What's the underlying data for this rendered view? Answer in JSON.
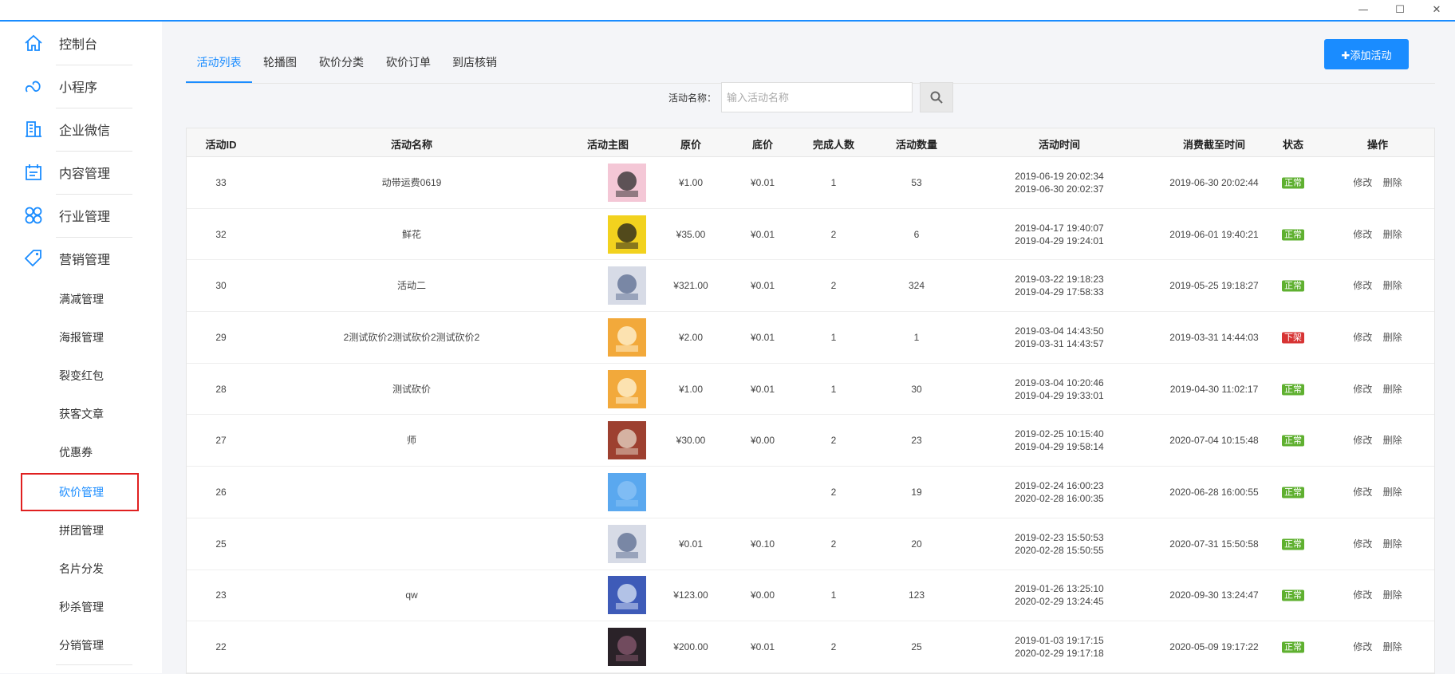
{
  "window": {
    "minimize": "—",
    "maximize": "☐",
    "close": "✕"
  },
  "sidebar": {
    "items": [
      {
        "label": "控制台",
        "icon": "home-icon"
      },
      {
        "label": "小程序",
        "icon": "mini-program-icon"
      },
      {
        "label": "企业微信",
        "icon": "building-icon"
      },
      {
        "label": "内容管理",
        "icon": "calendar-icon"
      },
      {
        "label": "行业管理",
        "icon": "grid-icon"
      },
      {
        "label": "营销管理",
        "icon": "tag-icon"
      }
    ],
    "sub_items": [
      "满减管理",
      "海报管理",
      "裂变红包",
      "获客文章",
      "优惠券",
      "砍价管理",
      "拼团管理",
      "名片分发",
      "秒杀管理",
      "分销管理"
    ],
    "active_sub": "砍价管理"
  },
  "tabs": [
    "活动列表",
    "轮播图",
    "砍价分类",
    "砍价订单",
    "到店核销"
  ],
  "add_button": "✚添加活动",
  "search": {
    "label": "活动名称：",
    "placeholder": "输入活动名称"
  },
  "table": {
    "headers": [
      "活动ID",
      "活动名称",
      "活动主图",
      "原价",
      "底价",
      "完成人数",
      "活动数量",
      "活动时间",
      "消费截至时间",
      "状态",
      "操作"
    ],
    "actions": {
      "edit": "修改",
      "delete": "删除"
    },
    "rows": [
      {
        "id": "33",
        "name": "动带运费0619",
        "price": "¥1.00",
        "floor": "¥0.01",
        "done": "1",
        "qty": "53",
        "start": "2019-06-19 20:02:34",
        "end": "2019-06-30 20:02:37",
        "expire": "2019-06-30 20:02:44",
        "status": "正常"
      },
      {
        "id": "32",
        "name": "鲜花",
        "price": "¥35.00",
        "floor": "¥0.01",
        "done": "2",
        "qty": "6",
        "start": "2019-04-17 19:40:07",
        "end": "2019-04-29 19:24:01",
        "expire": "2019-06-01 19:40:21",
        "status": "正常"
      },
      {
        "id": "30",
        "name": "活动二",
        "price": "¥321.00",
        "floor": "¥0.01",
        "done": "2",
        "qty": "324",
        "start": "2019-03-22 19:18:23",
        "end": "2019-04-29 17:58:33",
        "expire": "2019-05-25 19:18:27",
        "status": "正常"
      },
      {
        "id": "29",
        "name": "2测试砍价2测试砍价2测试砍价2",
        "price": "¥2.00",
        "floor": "¥0.01",
        "done": "1",
        "qty": "1",
        "start": "2019-03-04 14:43:50",
        "end": "2019-03-31 14:43:57",
        "expire": "2019-03-31 14:44:03",
        "status": "下架"
      },
      {
        "id": "28",
        "name": "测试砍价",
        "price": "¥1.00",
        "floor": "¥0.01",
        "done": "1",
        "qty": "30",
        "start": "2019-03-04 10:20:46",
        "end": "2019-04-29 19:33:01",
        "expire": "2019-04-30 11:02:17",
        "status": "正常"
      },
      {
        "id": "27",
        "name": "师",
        "price": "¥30.00",
        "floor": "¥0.00",
        "done": "2",
        "qty": "23",
        "start": "2019-02-25 10:15:40",
        "end": "2019-04-29 19:58:14",
        "expire": "2020-07-04 10:15:48",
        "status": "正常"
      },
      {
        "id": "26",
        "name": "",
        "price": "",
        "floor": "",
        "done": "2",
        "qty": "19",
        "start": "2019-02-24 16:00:23",
        "end": "2020-02-28 16:00:35",
        "expire": "2020-06-28 16:00:55",
        "status": "正常"
      },
      {
        "id": "25",
        "name": "",
        "price": "¥0.01",
        "floor": "¥0.10",
        "done": "2",
        "qty": "20",
        "start": "2019-02-23 15:50:53",
        "end": "2020-02-28 15:50:55",
        "expire": "2020-07-31 15:50:58",
        "status": "正常"
      },
      {
        "id": "23",
        "name": "qw",
        "price": "¥123.00",
        "floor": "¥0.00",
        "done": "1",
        "qty": "123",
        "start": "2019-01-26 13:25:10",
        "end": "2020-02-29 13:24:45",
        "expire": "2020-09-30 13:24:47",
        "status": "正常"
      },
      {
        "id": "22",
        "name": "",
        "price": "¥200.00",
        "floor": "¥0.01",
        "done": "2",
        "qty": "25",
        "start": "2019-01-03 19:17:15",
        "end": "2020-02-29 19:17:18",
        "expire": "2020-05-09 19:17:22",
        "status": "正常"
      }
    ]
  },
  "colors": {
    "accent": "#1a8cff",
    "ok": "#5fb030",
    "off": "#d73434"
  }
}
